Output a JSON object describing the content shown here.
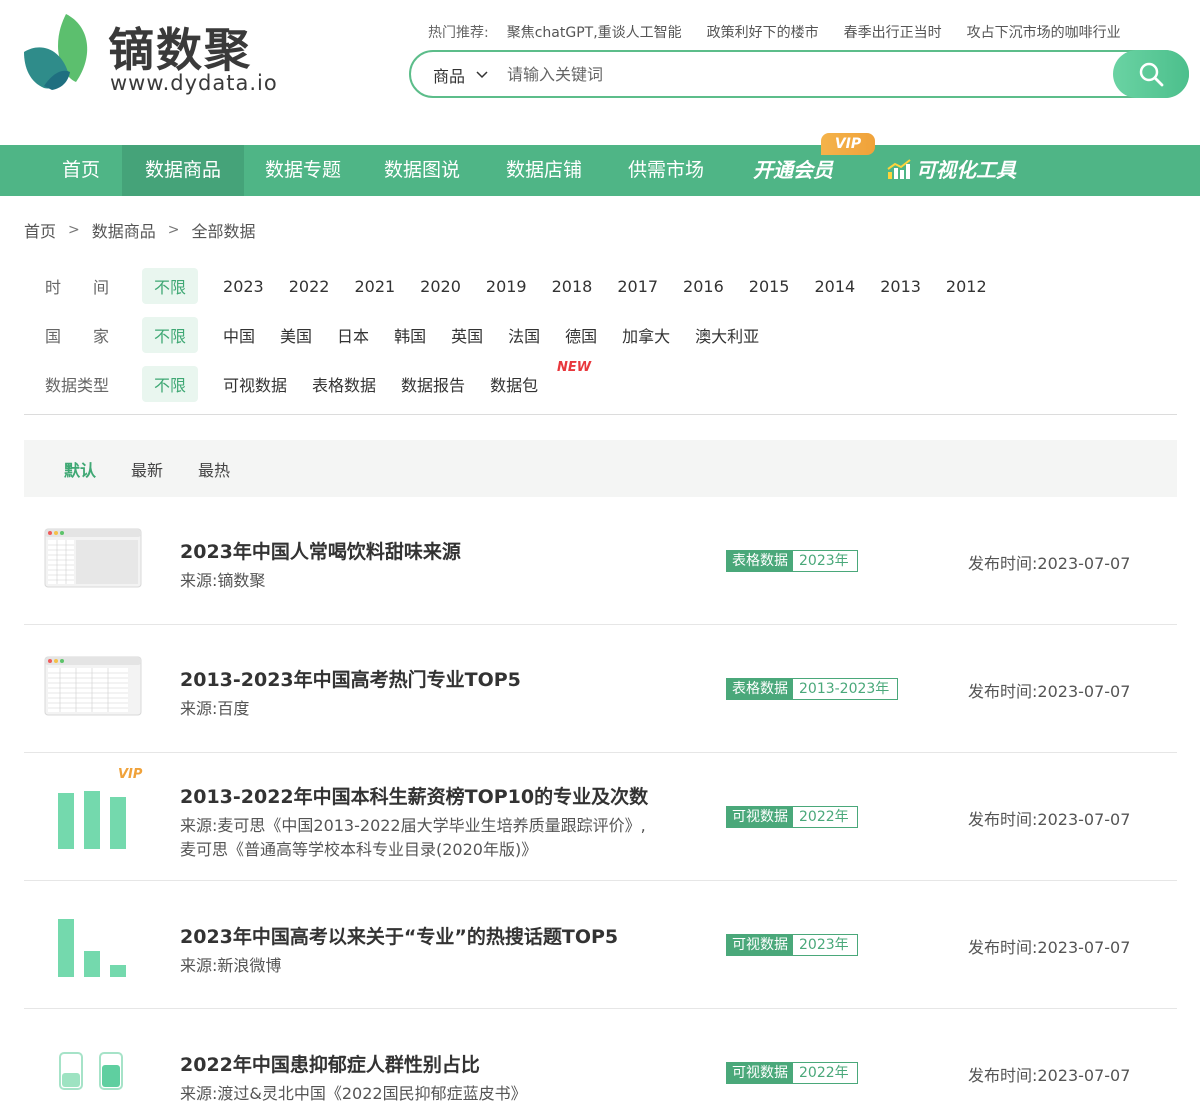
{
  "logo": {
    "name": "镝数聚",
    "url": "www.dydata.io"
  },
  "hot": {
    "label": "热门推荐:",
    "links": [
      "聚焦chatGPT,重谈人工智能",
      "政策利好下的楼市",
      "春季出行正当时",
      "攻占下沉市场的咖啡行业"
    ]
  },
  "search": {
    "category": "商品",
    "placeholder": "请输入关键词",
    "value": ""
  },
  "nav": {
    "items": [
      "首页",
      "数据商品",
      "数据专题",
      "数据图说",
      "数据店铺",
      "供需市场",
      "开通会员",
      "可视化工具"
    ],
    "vip_tag": "VIP",
    "active_index": 1
  },
  "breadcrumb": [
    "首页",
    "数据商品",
    "全部数据"
  ],
  "breadcrumb_sep": ">",
  "filters": {
    "time": {
      "label": "时　　间",
      "options": [
        "不限",
        "2023",
        "2022",
        "2021",
        "2020",
        "2019",
        "2018",
        "2017",
        "2016",
        "2015",
        "2014",
        "2013",
        "2012"
      ]
    },
    "country": {
      "label": "国　　家",
      "options": [
        "不限",
        "中国",
        "美国",
        "日本",
        "韩国",
        "英国",
        "法国",
        "德国",
        "加拿大",
        "澳大利亚"
      ]
    },
    "type": {
      "label": "数据类型",
      "options": [
        "不限",
        "可视数据",
        "表格数据",
        "数据报告",
        "数据包"
      ],
      "new_tag": "NEW"
    }
  },
  "sort": [
    "默认",
    "最新",
    "最热"
  ],
  "pub_label": "发布时间:",
  "items": [
    {
      "title": "2023年中国人常喝饮料甜味来源",
      "source": [
        "来源:镝数聚"
      ],
      "type": "表格数据",
      "year": "2023年",
      "date": "2023-07-07",
      "vip": "",
      "thumb": "table-window-icon"
    },
    {
      "title": "2013-2023年中国高考热门专业TOP5",
      "source": [
        "来源:百度"
      ],
      "type": "表格数据",
      "year": "2013-2023年",
      "date": "2023-07-07",
      "vip": "",
      "thumb": "table-window-icon"
    },
    {
      "title": "2013-2022年中国本科生薪资榜TOP10的专业及次数",
      "source": [
        "来源:麦可思《中国2013-2022届大学毕业生培养质量跟踪评价》,",
        "麦可思《普通高等学校本科专业目录(2020年版)》"
      ],
      "type": "可视数据",
      "year": "2022年",
      "date": "2023-07-07",
      "vip": "VIP",
      "thumb": "bar-chart-icon"
    },
    {
      "title": "2023年中国高考以来关于“专业”的热搜话题TOP5",
      "source": [
        "来源:新浪微博"
      ],
      "type": "可视数据",
      "year": "2023年",
      "date": "2023-07-07",
      "vip": "",
      "thumb": "descending-bar-icon"
    },
    {
      "title": "2022年中国患抑郁症人群性别占比",
      "source": [
        "来源:渡过&灵北中国《2022国民抑郁症蓝皮书》"
      ],
      "type": "可视数据",
      "year": "2022年",
      "date": "2023-07-07",
      "vip": "",
      "thumb": "jar-chart-icon"
    }
  ],
  "colors": {
    "brand": "#4fb586",
    "accent": "#3fa874",
    "vip": "#f0a23a",
    "new": "#e8383d"
  }
}
